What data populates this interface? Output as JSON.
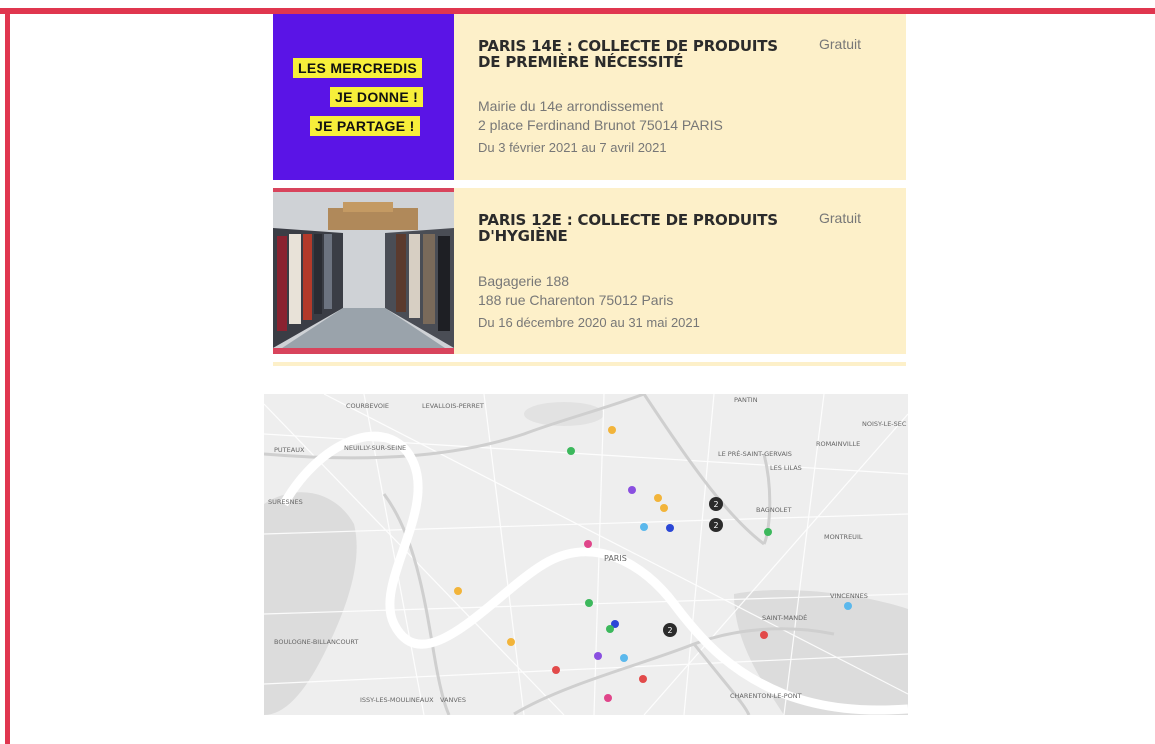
{
  "events": [
    {
      "thumb_badges": [
        "LES MERCREDIS",
        "JE DONNE !",
        "JE PARTAGE !"
      ],
      "title": "PARIS 14E : COLLECTE DE PRODUITS DE PREMIÈRE NÉCESSITÉ",
      "price": "Gratuit",
      "venue": "Mairie du 14e arrondissement",
      "address": "2 place Ferdinand Brunot 75014 PARIS",
      "dates": "Du 3 février 2021 au 7 avril 2021"
    },
    {
      "title": "PARIS 12E : COLLECTE DE PRODUITS D'HYGIÈNE",
      "price": "Gratuit",
      "venue": "Bagagerie 188",
      "address": "188 rue Charenton 75012 Paris",
      "dates": "Du 16 décembre 2020 au 31 mai 2021"
    }
  ],
  "map": {
    "labels": [
      "COURBEVOIE",
      "LEVALLOIS-PERRET",
      "PUTEAUX",
      "NEUILLY-SUR-SEINE",
      "SURESNES",
      "PANTIN",
      "NOISY-LE-SEC",
      "ROMAINVILLE",
      "LE PRÉ-SAINT-GERVAIS",
      "LES LILAS",
      "BAGNOLET",
      "MONTREUIL",
      "VINCENNES",
      "SAINT-MANDÉ",
      "PARIS",
      "BOULOGNE-BILLANCOURT",
      "ISSY-LES-MOULINEAUX",
      "VANVES",
      "CHARENTON-LE-PONT"
    ],
    "cluster_count": "2",
    "colors": {
      "green": "#3cb85c",
      "yellow": "#f2b43a",
      "purple": "#8a4fe0",
      "blue": "#2b47d6",
      "light_blue": "#5bb8ec",
      "pink": "#e0458a",
      "red": "#e24a4a",
      "cluster": "#2b2b2b"
    }
  }
}
